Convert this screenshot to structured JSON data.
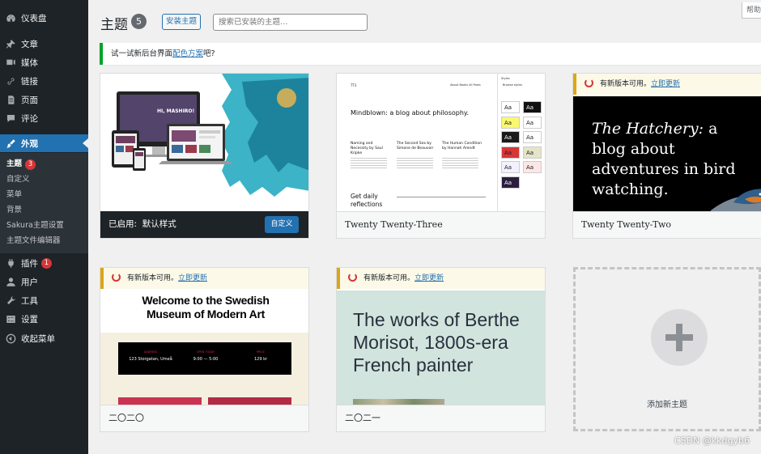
{
  "sidebar": {
    "items": [
      {
        "label": "仪表盘",
        "icon": "dashboard-icon"
      },
      {
        "label": "文章",
        "icon": "pin-icon"
      },
      {
        "label": "媒体",
        "icon": "media-icon"
      },
      {
        "label": "链接",
        "icon": "link-icon"
      },
      {
        "label": "页面",
        "icon": "page-icon"
      },
      {
        "label": "评论",
        "icon": "comment-icon"
      },
      {
        "label": "外观",
        "icon": "brush-icon"
      },
      {
        "label": "插件",
        "icon": "plugin-icon",
        "badge": "1"
      },
      {
        "label": "用户",
        "icon": "user-icon"
      },
      {
        "label": "工具",
        "icon": "wrench-icon"
      },
      {
        "label": "设置",
        "icon": "settings-icon"
      },
      {
        "label": "收起菜单",
        "icon": "collapse-icon"
      }
    ],
    "submenu": [
      {
        "label": "主题",
        "badge": "3"
      },
      {
        "label": "自定义"
      },
      {
        "label": "菜单"
      },
      {
        "label": "背景"
      },
      {
        "label": "Sakura主题设置"
      },
      {
        "label": "主题文件编辑器"
      }
    ]
  },
  "header": {
    "title": "主题",
    "count": "5",
    "add_button": "安装主题",
    "search_placeholder": "搜索已安装的主题…",
    "help_tab": "帮助"
  },
  "notice": {
    "prefix": "试一试新后台界面",
    "link": "配色方案",
    "suffix": "吧?"
  },
  "themes": {
    "active": {
      "active_label": "已启用:",
      "name": "默认样式",
      "customize": "自定义",
      "screenshot_text": "HI, MASHIRO!"
    },
    "tt3": {
      "name": "Twenty Twenty-Three",
      "headline": "Mindblown: a blog about philosophy.",
      "post1": "Naming and Necessity by Saul Kripke",
      "post2": "The Second Sex by Simone de Beauvoir",
      "post3": "The Human Condition by Hannah Arendt",
      "footer_text": "Get daily reflections",
      "nav_logo": "TT3",
      "nav_links": "About  Books  All Posts",
      "styles_title": "Styles",
      "styles_subtitle": "Browse styles",
      "swatch_label": "Aa"
    },
    "tt2": {
      "name": "Twenty Twenty-Two",
      "update_prefix": "有新版本可用。",
      "update_link": "立即更新",
      "headline_italic": "The Hatchery:",
      "headline_rest": " a blog about adventures in bird watching."
    },
    "tt20": {
      "name": "二〇二〇",
      "update_prefix": "有新版本可用。",
      "update_link": "立即更新",
      "headline": "Welcome to the Swedish Museum of Modern Art",
      "col1_title": "ADDRESS",
      "col1_value": "123 Storgatan, Umeå",
      "col2_title": "OPEN TODAY",
      "col2_value": "9:00 — 5:00",
      "col3_title": "PRICE",
      "col3_value": "129 kr"
    },
    "tt21": {
      "name": "二〇二一",
      "update_prefix": "有新版本可用。",
      "update_link": "立即更新",
      "headline": "The works of Berthe Morisot, 1800s-era French painter"
    }
  },
  "add_new": {
    "label": "添加新主题"
  },
  "watermark": "CSDN @kkdgyb6"
}
